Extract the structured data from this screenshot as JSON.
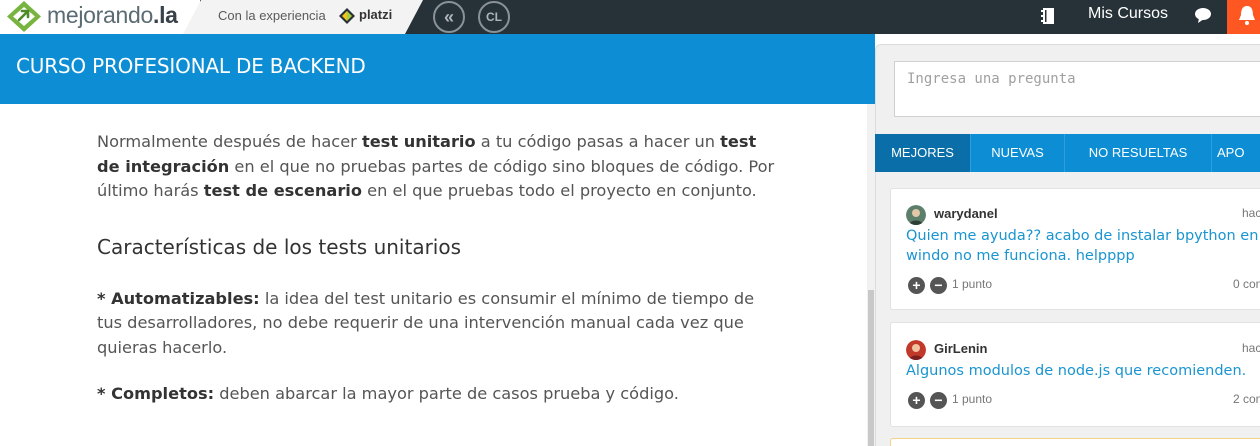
{
  "topbar": {
    "logo_prefix": "mejorando",
    "logo_suffix": ".la",
    "with_experience": "Con la experiencia",
    "platzi": "platzi",
    "circle_btn_1": "«",
    "circle_btn_2": "CL",
    "my_courses": "Mis Cursos",
    "colors": {
      "bar": "#263238",
      "notification": "#ff5722"
    }
  },
  "course": {
    "title": "CURSO PROFESIONAL DE BACKEND",
    "header_color": "#0d8ed4"
  },
  "article": {
    "p1": [
      "Normalmente después de hacer ",
      "test unitario",
      " a tu código pasas a hacer un ",
      "test de integración",
      " en el que no pruebas partes de código sino bloques de código. Por último harás ",
      "test de escenario",
      " en el que pruebas todo el proyecto en conjunto."
    ],
    "heading": "Características de los tests unitarios",
    "p2_bold": "* Automatizables:",
    "p2_text": " la idea del test unitario es consumir el mínimo de tiempo de tus desarrolladores, no debe requerir de una intervención manual cada vez que  quieras hacerlo.",
    "p3_bold": "* Completos:",
    "p3_text": " deben abarcar la mayor parte de casos prueba y código."
  },
  "panel": {
    "question_placeholder": "Ingresa una pregunta",
    "tabs": [
      "MEJORES",
      "NUEVAS",
      "NO RESUELTAS",
      "APO"
    ],
    "questions": [
      {
        "author": "warydanel",
        "time": "hac",
        "text": "Quien me ayuda?? acabo de instalar bpython en windo no me funciona. helpppp",
        "points": "1 punto",
        "comments": "0 con"
      },
      {
        "author": "GirLenin",
        "time": "hac",
        "text": "Algunos modulos de node.js que recomienden.",
        "points": "1 punto",
        "comments": "2 con"
      }
    ],
    "vote_up": "+",
    "vote_down": "−"
  }
}
